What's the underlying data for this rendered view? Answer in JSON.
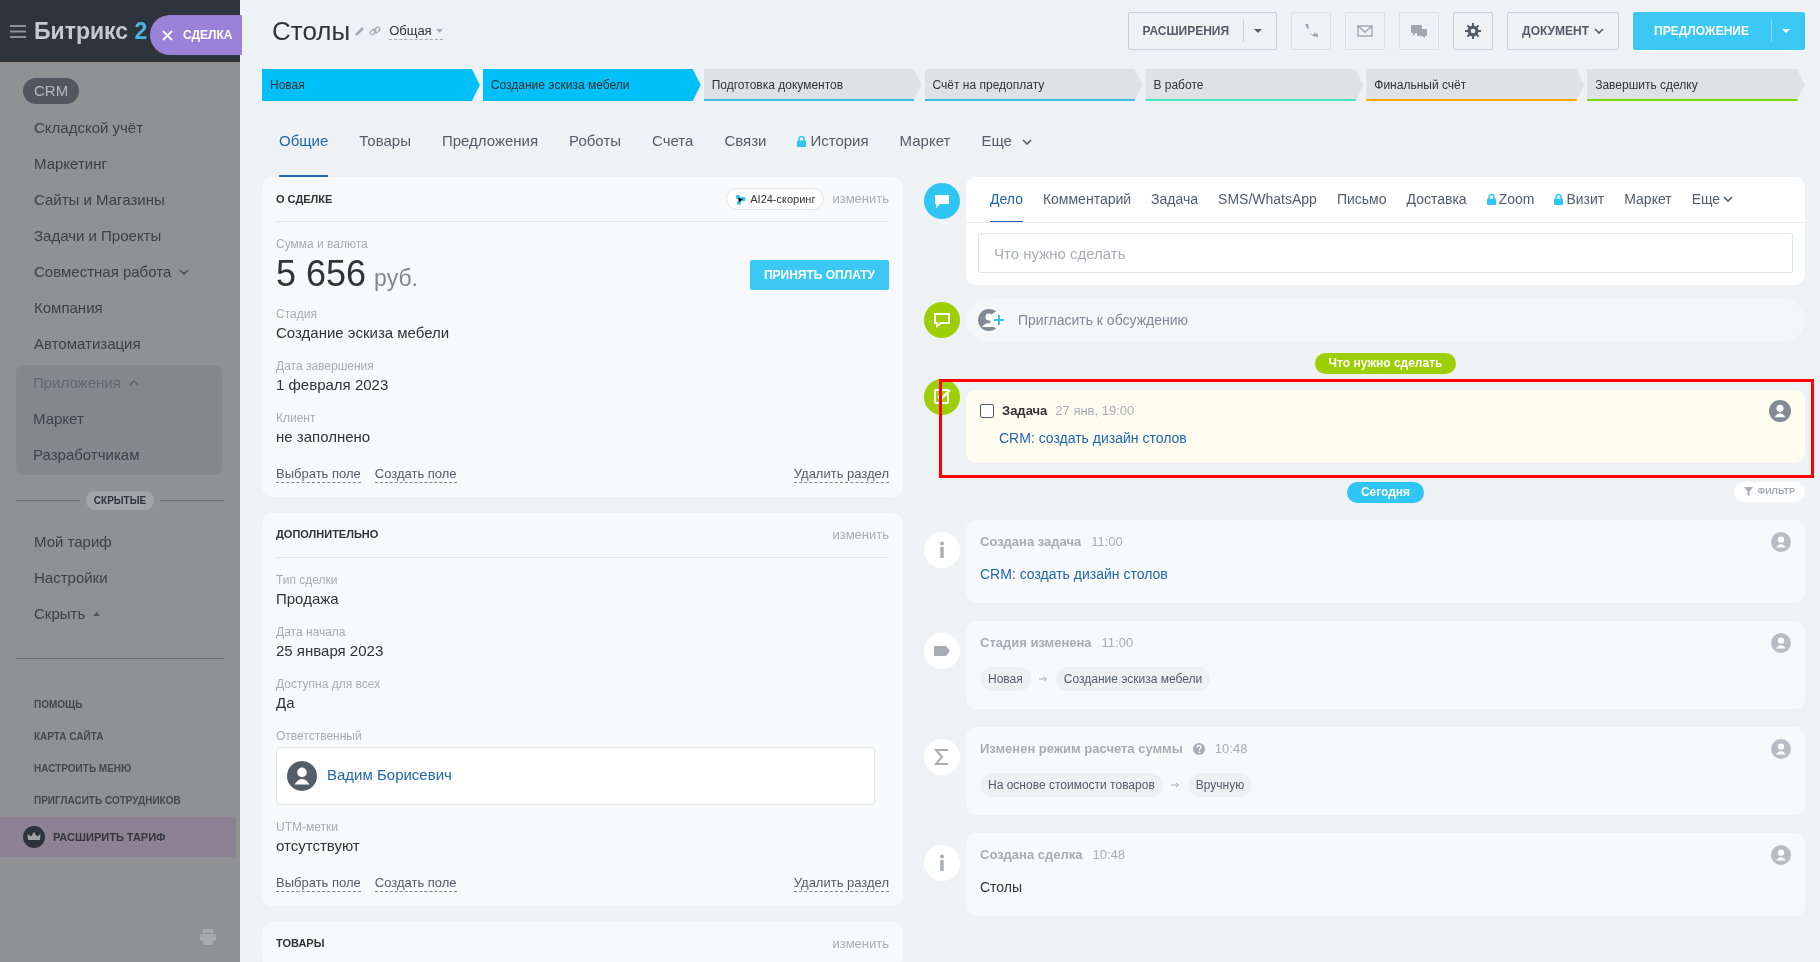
{
  "sidebar": {
    "logo_text": "Битрикс",
    "logo_number": "2",
    "slider_tab": "СДЕЛКА",
    "items": [
      {
        "label": "CRM",
        "kind": "link",
        "selected": true
      },
      {
        "label": "Складской учёт",
        "kind": "link",
        "selected": false
      },
      {
        "label": "Маркетинг",
        "kind": "link",
        "selected": false
      },
      {
        "label": "Сайты и Магазины",
        "kind": "link",
        "selected": false
      },
      {
        "label": "Задачи и Проекты",
        "kind": "link",
        "selected": false
      },
      {
        "label": "Совместная работа",
        "kind": "group",
        "expanded": false,
        "selected": false
      },
      {
        "label": "Компания",
        "kind": "link",
        "selected": false
      },
      {
        "label": "Автоматизация",
        "kind": "link",
        "selected": false
      },
      {
        "label": "Приложения",
        "kind": "group",
        "expanded": true,
        "selected": false,
        "children": [
          {
            "label": "Маркет",
            "kind": "link",
            "selected": false
          },
          {
            "label": "Разработчикам",
            "kind": "link",
            "selected": false
          }
        ]
      }
    ],
    "hidden_label": "СКРЫТЫЕ",
    "hidden_items": [
      {
        "label": "Мой тариф",
        "selected": false
      },
      {
        "label": "Настройки",
        "selected": false
      }
    ],
    "hide_toggle": "Скрыть",
    "footer_links": [
      "ПОМОЩЬ",
      "КАРТА САЙТА",
      "НАСТРОИТЬ МЕНЮ",
      "ПРИГЛАСИТЬ СОТРУДНИКОВ"
    ],
    "upgrade": "РАСШИРИТЬ ТАРИФ"
  },
  "header": {
    "title": "Столы",
    "category": "Общая",
    "buttons": [
      {
        "kind": "split",
        "label": "РАСШИРЕНИЯ",
        "disabled": false
      },
      {
        "kind": "call",
        "disabled": true
      },
      {
        "kind": "email",
        "disabled": true
      },
      {
        "kind": "messages",
        "disabled": true
      },
      {
        "kind": "settings",
        "disabled": false
      },
      {
        "kind": "dropdown",
        "label": "ДОКУМЕНТ",
        "disabled": false
      },
      {
        "kind": "primary-split",
        "label": "ПРЕДЛОЖЕНИЕ",
        "disabled": false
      }
    ]
  },
  "stages": [
    {
      "label": "Новая",
      "passed": true,
      "color": "#00c0fa"
    },
    {
      "label": "Создание эскиза мебели",
      "passed": true,
      "color": "#00c0fa"
    },
    {
      "label": "Подготовка документов",
      "passed": false,
      "color": "#39bfe6"
    },
    {
      "label": "Счёт на предоплату",
      "passed": false,
      "color": "#39bfe6"
    },
    {
      "label": "В работе",
      "passed": false,
      "color": "#47e4c2"
    },
    {
      "label": "Финальный счёт",
      "passed": false,
      "color": "#ffa900"
    },
    {
      "label": "Завершить сделку",
      "passed": false,
      "color": "#7bd500"
    }
  ],
  "tabs": [
    {
      "label": "Общие",
      "selected": true
    },
    {
      "label": "Товары",
      "selected": false
    },
    {
      "label": "Предложения",
      "selected": false
    },
    {
      "label": "Роботы",
      "selected": false
    },
    {
      "label": "Счета",
      "selected": false
    },
    {
      "label": "Связи",
      "selected": false
    },
    {
      "label": "История",
      "selected": false,
      "locked": true
    },
    {
      "label": "Маркет",
      "selected": false
    },
    {
      "label": "Еще",
      "selected": false,
      "kind": "more"
    }
  ],
  "sections": [
    {
      "title": "О СДЕЛКЕ",
      "badge": "AI24-скоринг",
      "action": "изменить",
      "amount_label": "Сумма и валюта",
      "amount": "5 656",
      "currency": "руб.",
      "pay_button": "ПРИНЯТЬ ОПЛАТУ",
      "fields": [
        {
          "label": "Стадия",
          "value": "Создание эскиза мебели"
        },
        {
          "label": "Дата завершения",
          "value": "1 февраля 2023"
        },
        {
          "label": "Клиент",
          "value": "не заполнено"
        }
      ],
      "links": [
        "Выбрать поле",
        "Создать поле"
      ],
      "delete": "Удалить раздел"
    },
    {
      "title": "ДОПОЛНИТЕЛЬНО",
      "action": "изменить",
      "fields": [
        {
          "label": "Тип сделки",
          "value": "Продажа"
        },
        {
          "label": "Дата начала",
          "value": "25 января 2023"
        },
        {
          "label": "Доступна для всех",
          "value": "Да"
        },
        {
          "label": "Ответственный",
          "value": "Вадим Борисевич",
          "kind": "user"
        },
        {
          "label": "UTM-метки",
          "value": "отсутствуют"
        }
      ],
      "links": [
        "Выбрать поле",
        "Создать поле"
      ],
      "delete": "Удалить раздел"
    },
    {
      "title": "ТОВАРЫ",
      "action": "изменить"
    }
  ],
  "timeline": {
    "composer_tabs": [
      {
        "label": "Дело",
        "selected": true
      },
      {
        "label": "Комментарий",
        "selected": false
      },
      {
        "label": "Задача",
        "selected": false
      },
      {
        "label": "SMS/WhatsApp",
        "selected": false
      },
      {
        "label": "Письмо",
        "selected": false
      },
      {
        "label": "Доставка",
        "selected": false
      },
      {
        "label": "Zoom",
        "selected": false,
        "locked": true
      },
      {
        "label": "Визит",
        "selected": false,
        "locked": true
      },
      {
        "label": "Маркет",
        "selected": false
      },
      {
        "label": "Еще",
        "selected": false,
        "kind": "more"
      }
    ],
    "composer_placeholder": "Что нужно сделать",
    "invite": "Пригласить к обсуждению",
    "planned_label": "Что нужно сделать",
    "planned": [
      {
        "title": "Задача",
        "time": "27 янв, 19:00",
        "link": "CRM: создать дизайн столов",
        "checked": false,
        "highlighted": true
      }
    ],
    "today_label": "Сегодня",
    "filter": "ФИЛЬТР",
    "history": [
      {
        "kind": "info",
        "title": "Создана задача",
        "time": "11:00",
        "link": "CRM: создать дизайн столов"
      },
      {
        "kind": "stage",
        "title": "Стадия изменена",
        "time": "11:00",
        "from": "Новая",
        "to": "Создание эскиза мебели"
      },
      {
        "kind": "sum",
        "title": "Изменен режим расчета суммы",
        "time": "10:48",
        "help": true,
        "from": "На основе стоимости товаров",
        "to": "Вручную"
      },
      {
        "kind": "info",
        "title": "Создана сделка",
        "time": "10:48",
        "text": "Столы"
      }
    ]
  }
}
